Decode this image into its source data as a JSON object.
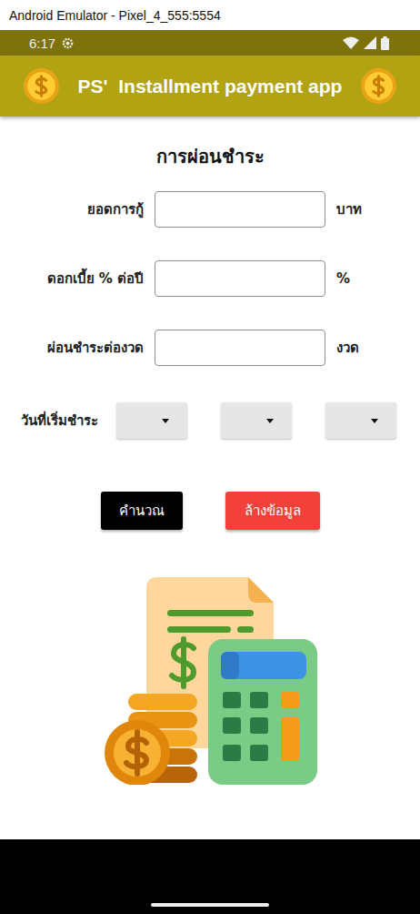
{
  "window": {
    "title": "Android Emulator - Pixel_4_555:5554"
  },
  "status_bar": {
    "time": "6:17"
  },
  "app_bar": {
    "title": "PS'  Installment payment app"
  },
  "form": {
    "title": "การผ่อนชำระ",
    "fields": [
      {
        "label": "ยอดการกู้",
        "value": "",
        "unit": "บาท"
      },
      {
        "label": "ดอกเบี้ย % ต่อปี",
        "value": "",
        "unit": "%"
      },
      {
        "label": "ผ่อนชำระต่องวด",
        "value": "",
        "unit": "งวด"
      }
    ],
    "date": {
      "label": "วันที่เริ่มชำระ",
      "dropdowns": [
        {
          "value": ""
        },
        {
          "value": ""
        },
        {
          "value": ""
        }
      ]
    }
  },
  "buttons": [
    {
      "label": "คำนวณ",
      "kind": "primary"
    },
    {
      "label": "ล้างข้อมูล",
      "kind": "danger"
    }
  ]
}
